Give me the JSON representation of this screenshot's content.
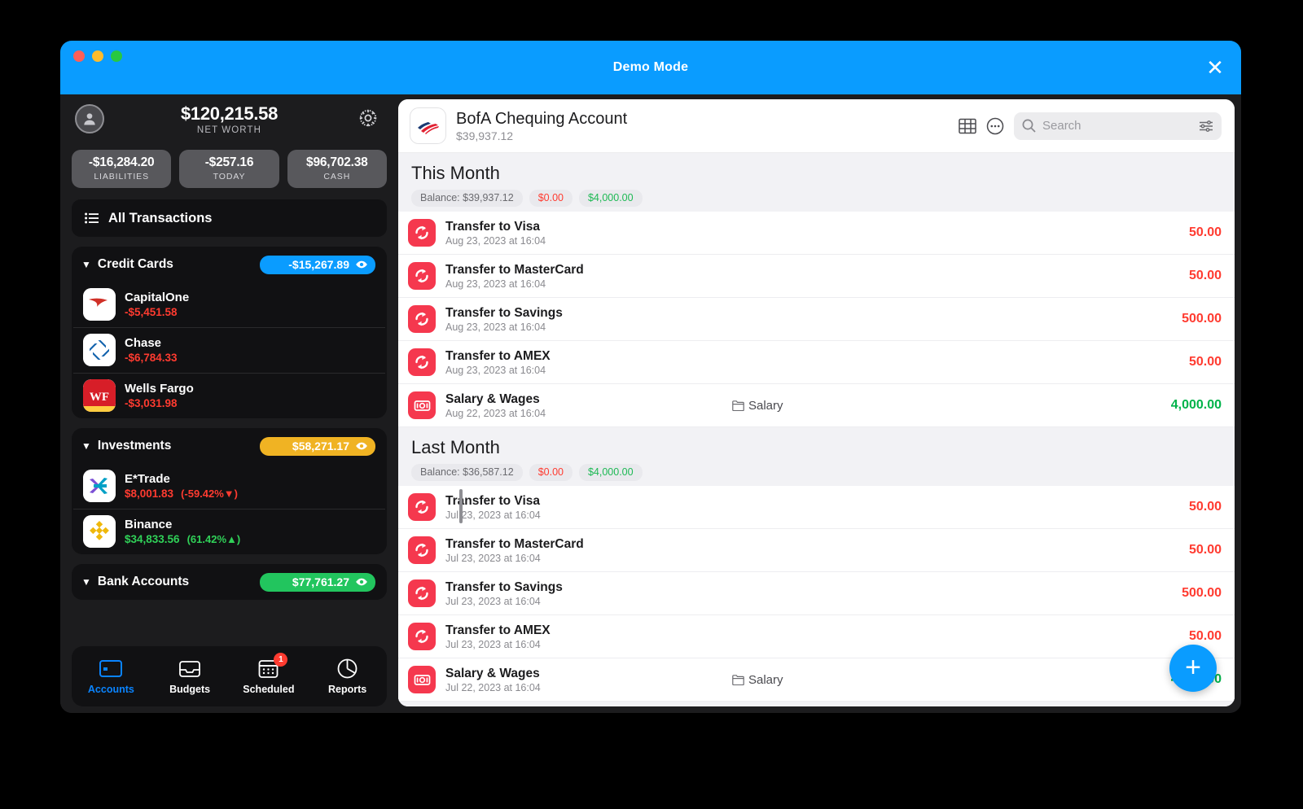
{
  "window": {
    "title": "Demo Mode",
    "close_label": "✕",
    "accent": "#0a9cff"
  },
  "sidebar": {
    "net_worth": {
      "amount": "$120,215.58",
      "label": "NET WORTH"
    },
    "avatar_icon": "person-icon",
    "settings_icon": "gear-icon",
    "stats": [
      {
        "amount": "-$16,284.20",
        "label": "LIABILITIES"
      },
      {
        "amount": "-$257.16",
        "label": "TODAY"
      },
      {
        "amount": "$96,702.38",
        "label": "CASH"
      }
    ],
    "all_transactions": {
      "label": "All Transactions",
      "icon": "list-icon"
    },
    "groups": [
      {
        "title": "Credit Cards",
        "caret": "▼",
        "total": "-$15,267.89",
        "badge_color": "#0a9cff",
        "accounts": [
          {
            "name": "CapitalOne",
            "balance": "-$5,451.58",
            "balance_class": "neg",
            "change": "",
            "icon": "capitalone-logo"
          },
          {
            "name": "Chase",
            "balance": "-$6,784.33",
            "balance_class": "neg",
            "change": "",
            "icon": "chase-logo"
          },
          {
            "name": "Wells Fargo",
            "balance": "-$3,031.98",
            "balance_class": "neg",
            "change": "",
            "icon": "wellsfargo-logo"
          }
        ]
      },
      {
        "title": "Investments",
        "caret": "▼",
        "total": "$58,271.17",
        "badge_color": "#f0b323",
        "accounts": [
          {
            "name": "E*Trade",
            "balance": "$8,001.83",
            "balance_class": "neg",
            "change": "(-59.42%▼)",
            "change_class": "pct-neg",
            "icon": "etrade-logo"
          },
          {
            "name": "Binance",
            "balance": "$34,833.56",
            "balance_class": "pos",
            "change": "(61.42%▲)",
            "change_class": "pct-pos",
            "icon": "binance-logo"
          }
        ]
      },
      {
        "title": "Bank Accounts",
        "caret": "▼",
        "total": "$77,761.27",
        "badge_color": "#22c55e",
        "accounts": []
      }
    ],
    "tabs": [
      {
        "label": "Accounts",
        "icon": "card-icon",
        "active": true,
        "badge": ""
      },
      {
        "label": "Budgets",
        "icon": "tray-icon",
        "active": false,
        "badge": ""
      },
      {
        "label": "Scheduled",
        "icon": "calendar-icon",
        "active": false,
        "badge": "1"
      },
      {
        "label": "Reports",
        "icon": "piechart-icon",
        "active": false,
        "badge": ""
      }
    ]
  },
  "main": {
    "account": {
      "icon": "bofa-logo",
      "title": "BofA Chequing Account",
      "balance": "$39,937.12"
    },
    "toolbar": {
      "table_icon": "table-icon",
      "more_icon": "more-circle-icon",
      "search_icon": "search-icon",
      "search_placeholder": "Search",
      "search_value": "",
      "filter_icon": "filter-sliders-icon"
    },
    "sections": [
      {
        "title": "This Month",
        "pills": [
          {
            "text": "Balance: $39,937.12",
            "style": ""
          },
          {
            "text": "$0.00",
            "style": "red"
          },
          {
            "text": "$4,000.00",
            "style": "green"
          }
        ],
        "transactions": [
          {
            "name": "Transfer to Visa",
            "date": "Aug 23, 2023 at 16:04",
            "category": "",
            "amount": "50.00",
            "amount_class": "red",
            "icon": "transfer-icon"
          },
          {
            "name": "Transfer to MasterCard",
            "date": "Aug 23, 2023 at 16:04",
            "category": "",
            "amount": "50.00",
            "amount_class": "red",
            "icon": "transfer-icon"
          },
          {
            "name": "Transfer to Savings",
            "date": "Aug 23, 2023 at 16:04",
            "category": "",
            "amount": "500.00",
            "amount_class": "red",
            "icon": "transfer-icon"
          },
          {
            "name": "Transfer to AMEX",
            "date": "Aug 23, 2023 at 16:04",
            "category": "",
            "amount": "50.00",
            "amount_class": "red",
            "icon": "transfer-icon"
          },
          {
            "name": "Salary & Wages",
            "date": "Aug 22, 2023 at 16:04",
            "category": "Salary",
            "amount": "4,000.00",
            "amount_class": "green",
            "icon": "money-icon"
          }
        ]
      },
      {
        "title": "Last Month",
        "pills": [
          {
            "text": "Balance: $36,587.12",
            "style": ""
          },
          {
            "text": "$0.00",
            "style": "red"
          },
          {
            "text": "$4,000.00",
            "style": "green"
          }
        ],
        "transactions": [
          {
            "name": "Transfer to Visa",
            "date": "Jul 23, 2023 at 16:04",
            "category": "",
            "amount": "50.00",
            "amount_class": "red",
            "icon": "transfer-icon"
          },
          {
            "name": "Transfer to MasterCard",
            "date": "Jul 23, 2023 at 16:04",
            "category": "",
            "amount": "50.00",
            "amount_class": "red",
            "icon": "transfer-icon"
          },
          {
            "name": "Transfer to Savings",
            "date": "Jul 23, 2023 at 16:04",
            "category": "",
            "amount": "500.00",
            "amount_class": "red",
            "icon": "transfer-icon"
          },
          {
            "name": "Transfer to AMEX",
            "date": "Jul 23, 2023 at 16:04",
            "category": "",
            "amount": "50.00",
            "amount_class": "red",
            "icon": "transfer-icon"
          },
          {
            "name": "Salary & Wages",
            "date": "Jul 22, 2023 at 16:04",
            "category": "Salary",
            "amount": "4,000.00",
            "amount_class": "green",
            "icon": "money-icon"
          }
        ]
      }
    ],
    "fab": {
      "label": "+",
      "icon": "plus-icon"
    }
  }
}
